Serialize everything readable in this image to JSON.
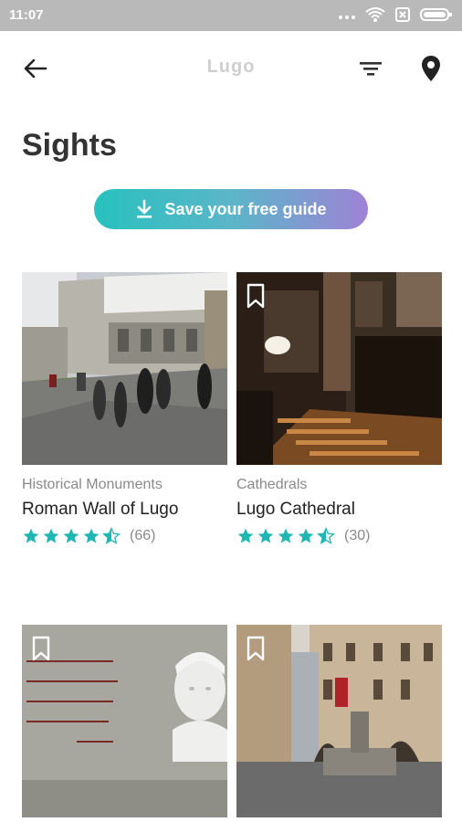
{
  "status_bar": {
    "time": "11:07"
  },
  "app_bar": {
    "title": "Lugo"
  },
  "heading": "Sights",
  "save_button": {
    "label": "Save your free guide"
  },
  "colors": {
    "accent": "#27c1bd",
    "accent_end": "#9f82d6",
    "star": "#1fb7b3"
  },
  "sights": [
    {
      "category": "Historical Monuments",
      "name": "Roman Wall of Lugo",
      "rating": 4.5,
      "count": "(66)"
    },
    {
      "category": "Cathedrals",
      "name": "Lugo Cathedral",
      "rating": 4.5,
      "count": "(30)"
    },
    {
      "category": "",
      "name": "",
      "rating": null,
      "count": ""
    },
    {
      "category": "",
      "name": "",
      "rating": null,
      "count": ""
    }
  ]
}
